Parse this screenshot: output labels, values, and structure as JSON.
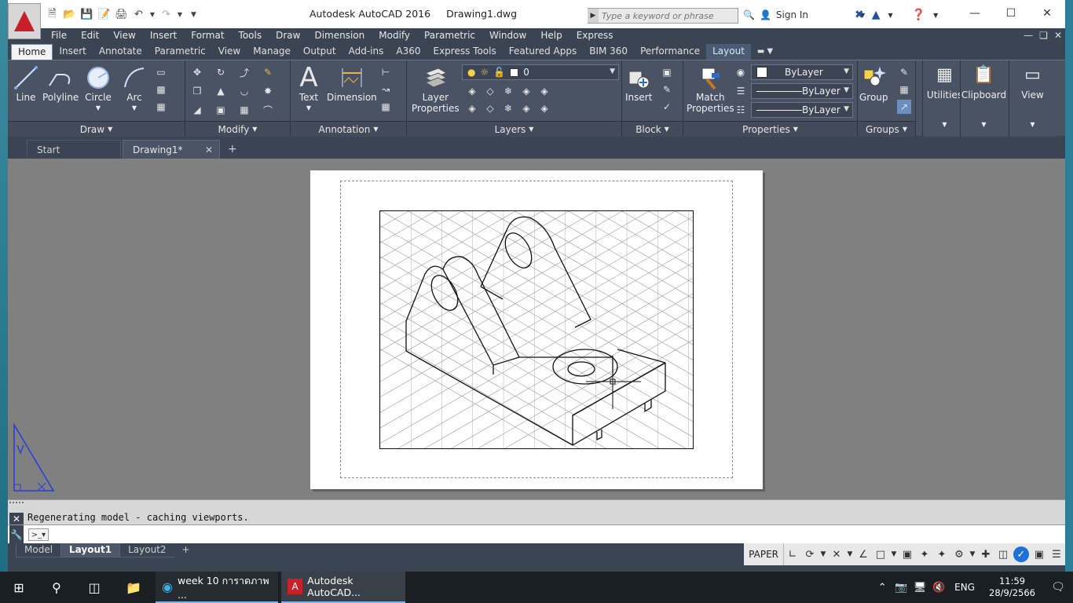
{
  "titlebar": {
    "app_name": "Autodesk AutoCAD 2016",
    "document": "Drawing1.dwg",
    "search_placeholder": "Type a keyword or phrase",
    "sign_in": "Sign In"
  },
  "menu": [
    "File",
    "Edit",
    "View",
    "Insert",
    "Format",
    "Tools",
    "Draw",
    "Dimension",
    "Modify",
    "Parametric",
    "Window",
    "Help",
    "Express"
  ],
  "ribbon_tabs": [
    "Home",
    "Insert",
    "Annotate",
    "Parametric",
    "View",
    "Manage",
    "Output",
    "Add-ins",
    "A360",
    "Express Tools",
    "Featured Apps",
    "BIM 360",
    "Performance",
    "Layout"
  ],
  "ribbon": {
    "draw": {
      "title": "Draw",
      "line": "Line",
      "polyline": "Polyline",
      "circle": "Circle",
      "arc": "Arc"
    },
    "modify": {
      "title": "Modify"
    },
    "annotation": {
      "title": "Annotation",
      "text": "Text",
      "dimension": "Dimension"
    },
    "layers": {
      "title": "Layers",
      "layer_properties_1": "Layer",
      "layer_properties_2": "Properties",
      "current_layer": "0"
    },
    "block": {
      "title": "Block",
      "insert": "Insert"
    },
    "properties": {
      "title": "Properties",
      "match_1": "Match",
      "match_2": "Properties",
      "color": "ByLayer",
      "linetype": "ByLayer",
      "lineweight": "ByLayer"
    },
    "groups": {
      "title": "Groups",
      "group": "Group"
    },
    "utilities": "Utilities",
    "clipboard": "Clipboard",
    "view": "View"
  },
  "file_tabs": {
    "start": "Start",
    "drawing": "Drawing1*"
  },
  "command": {
    "history": "Regenerating model - caching viewports.",
    "input_value": ""
  },
  "layout_tabs": [
    "Model",
    "Layout1",
    "Layout2"
  ],
  "status": {
    "space": "PAPER"
  },
  "taskbar": {
    "edge_title": "week 10 การาดภาพ ...",
    "acad_title": "Autodesk AutoCAD...",
    "language": "ENG",
    "time": "11:59",
    "date": "28/9/2566"
  },
  "colors": {
    "app_bg": "#3b4453",
    "ribbon_bg": "#4a5364",
    "canvas_bg": "#808080",
    "acad_red": "#c7202b",
    "taskbar_bg": "#1a1f24"
  }
}
